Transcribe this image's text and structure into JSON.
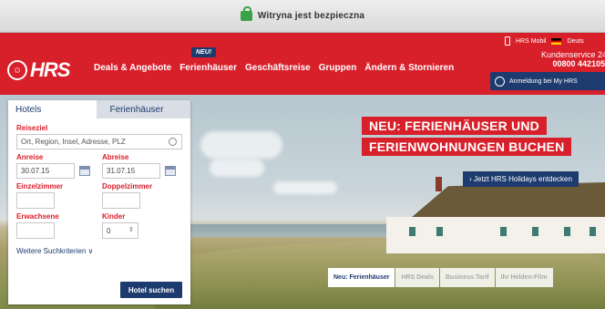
{
  "browser": {
    "security_text": "Witryna jest bezpieczna"
  },
  "header": {
    "logo_text": "HRS",
    "new_badge": "NEU!",
    "nav": [
      "Deals & Angebote",
      "Ferienhäuser",
      "Geschäftsreise",
      "Gruppen",
      "Ändern & Stornieren"
    ],
    "mobile_label": "HRS Mobil",
    "language_label": "Deuts",
    "service_label": "Kundenservice 24",
    "service_phone": "00800 442105",
    "login_label": "Anmeldung bei My HRS"
  },
  "hero": {
    "headline_1": "NEU: FERIENHÄUSER UND",
    "headline_2": "FERIENWOHNUNGEN BUCHEN",
    "cta_link": "› Jetzt HRS Holidays entdecken",
    "slides": [
      "Neu: Ferienhäuser",
      "HRS Deals",
      "Business Tarif",
      "Ihr Helden-Film"
    ]
  },
  "search": {
    "tabs": [
      "Hotels",
      "Ferienhäuser"
    ],
    "destination_label": "Reiseziel",
    "destination_placeholder": "Ort, Region, Insel, Adresse, PLZ",
    "arrival_label": "Anreise",
    "arrival_value": "30.07.15",
    "departure_label": "Abreise",
    "departure_value": "31.07.15",
    "single_label": "Einzelzimmer",
    "double_label": "Doppelzimmer",
    "adults_label": "Erwachsene",
    "children_label": "Kinder",
    "children_value": "0",
    "more_criteria": "Weitere Suchkriterien ∨",
    "submit_label": "Hotel suchen"
  },
  "colors": {
    "brand_red": "#d8202b",
    "brand_blue": "#1d3b6e"
  }
}
